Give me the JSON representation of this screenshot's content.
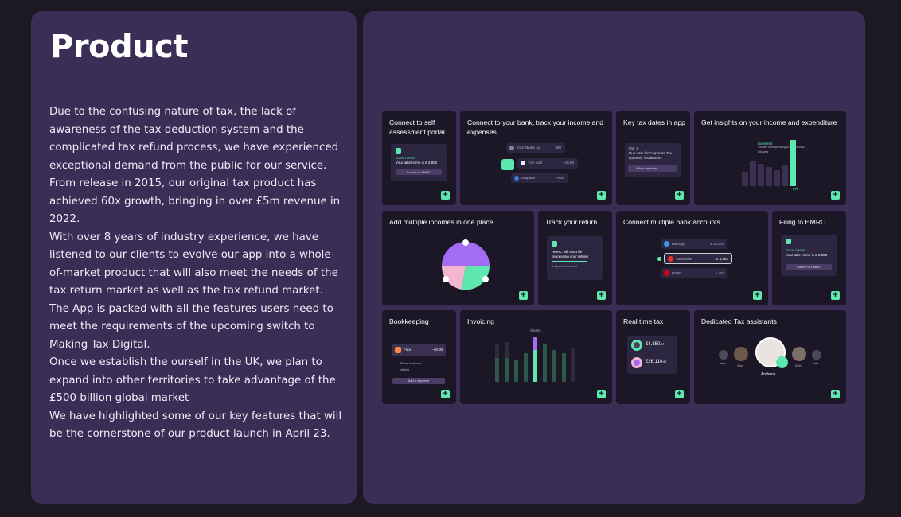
{
  "product": {
    "title": "Product",
    "paragraphs": [
      "Due to the confusing nature of tax, the lack of awareness of the tax deduction system and the complicated tax refund process, we have experienced exceptional demand from the public for our service. From release in 2015, our original tax product has achieved 60x growth, bringing in over £5m revenue in 2022.",
      "With over 8 years of industry experience, we have listened to our clients to evolve our app into a whole-of-market product that will also meet the needs of the tax return market as well as the tax refund market. The App is packed with all the features users need to meet the requirements of the upcoming switch to Making Tax Digital.",
      "Once we establish the ourself in the UK, we plan to expand into other territories to take advantage of the £500 billion global market",
      "We have highlighted some of our key features that will be the cornerstone of our product launch in April 23."
    ]
  },
  "features": {
    "plus": "+",
    "cards": [
      {
        "title": "Connect to self assessment portal"
      },
      {
        "title": "Connect to your bank, track your income and expenses"
      },
      {
        "title": "Key tax dates in app"
      },
      {
        "title": "Get insights on your income and expenditure"
      },
      {
        "title": "Add multiple incomes in one place"
      },
      {
        "title": "Track your return"
      },
      {
        "title": "Connect multiple bank accounts"
      },
      {
        "title": "Filing to HMRC"
      },
      {
        "title": "Bookkeeping"
      },
      {
        "title": "Invoicing"
      },
      {
        "title": "Real time tax"
      },
      {
        "title": "Dedicated Tax assistants"
      }
    ],
    "self_assessment": {
      "good_news": "Good news!",
      "line": "Your take home is £ 2,800",
      "button": "Submit to HMRC"
    },
    "bank_track": {
      "row1": "Your Media Ltd",
      "val1": "900",
      "row2": "Tom sold",
      "val2": "+16.00",
      "row3": "Dropbox",
      "val3": "-9.00"
    },
    "tax_dates": {
      "line1": "Mar 1",
      "line2": "Due date for Corporate Tax quarterly instalments",
      "button": "Add a reminder"
    },
    "insights": {
      "note1": "Excellent",
      "note2": "You are now spending a bit less than last year",
      "highlight": "27k"
    },
    "track_return": {
      "line1": "HMRC will soon be",
      "line2": "processing your refund",
      "line3": "4 days left to cancel"
    },
    "bank_accounts": {
      "b1": "Barclays",
      "v1": "£ 22,829",
      "b2": "Santander",
      "v2": "£ 4,582",
      "b3": "HSBC",
      "v3": "£ 402"
    },
    "hmrc": {
      "good_news": "Good news!",
      "line": "Your take home is £ 2,800",
      "button": "Submit to HMRC"
    },
    "bookkeeping": {
      "item": "Food",
      "amount": "-48.00",
      "row1": "Allowa business",
      "row2": "Vehicle",
      "button": "Add a expense"
    },
    "invoicing": {
      "legend": "Clients"
    },
    "realtime": {
      "v1": "£4,350",
      "v1d": ".67",
      "v2": "£26,114",
      "v2d": ".67"
    },
    "assistants": {
      "main": "Anthony",
      "p1": "Jack",
      "p2": "Cloe",
      "p3": "Emily",
      "p4": "Jake"
    }
  }
}
